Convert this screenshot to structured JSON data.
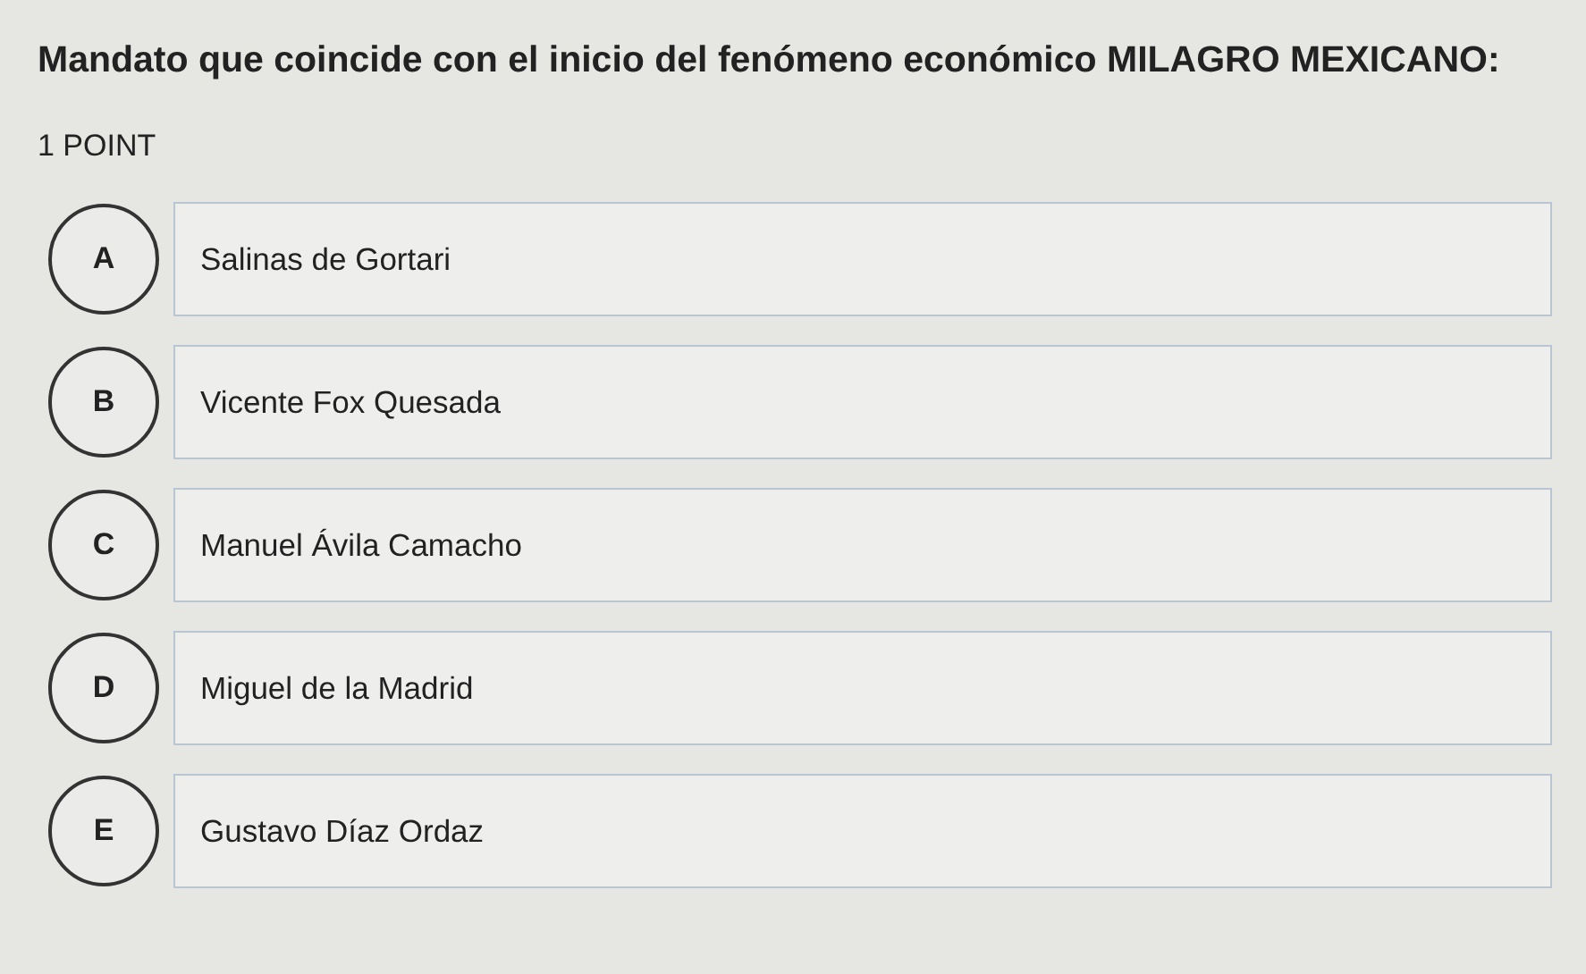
{
  "question": {
    "text": "Mandato que coincide con el inicio del fenómeno económico MILAGRO MEXICANO:",
    "points": "1 POINT"
  },
  "options": [
    {
      "letter": "A",
      "text": "Salinas de Gortari"
    },
    {
      "letter": "B",
      "text": "Vicente Fox Quesada"
    },
    {
      "letter": "C",
      "text": "Manuel Ávila Camacho"
    },
    {
      "letter": "D",
      "text": "Miguel de la Madrid"
    },
    {
      "letter": "E",
      "text": "Gustavo Díaz Ordaz"
    }
  ]
}
